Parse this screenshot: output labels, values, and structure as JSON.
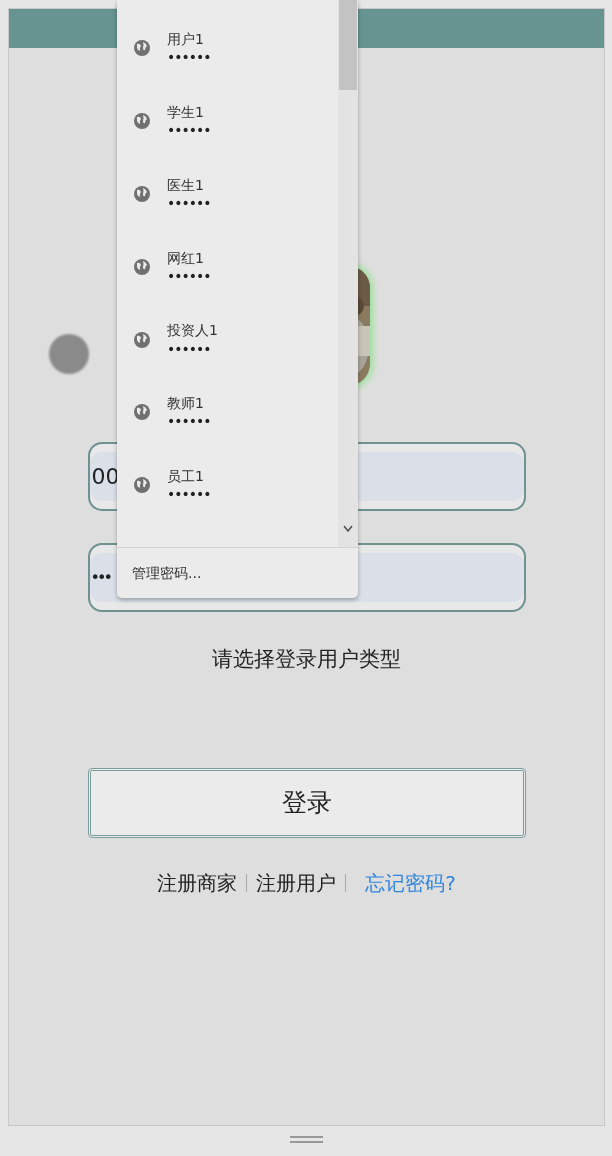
{
  "username_field": {
    "value": "00"
  },
  "password_field": {
    "value": "•••"
  },
  "user_type_prompt": "请选择登录用户类型",
  "login_button": "登录",
  "links": [
    {
      "label": "注册商家",
      "kind": "plain"
    },
    {
      "label": "注册用户",
      "kind": "plain"
    },
    {
      "label": "忘记密码?",
      "kind": "accent"
    }
  ],
  "autofill_menu": {
    "items": [
      {
        "username": "用户1",
        "password": "••••••"
      },
      {
        "username": "学生1",
        "password": "••••••"
      },
      {
        "username": "医生1",
        "password": "••••••"
      },
      {
        "username": "网红1",
        "password": "••••••"
      },
      {
        "username": "投资人1",
        "password": "••••••"
      },
      {
        "username": "教师1",
        "password": "••••••"
      },
      {
        "username": "员工1",
        "password": "••••••"
      }
    ],
    "footer": "管理密码..."
  }
}
